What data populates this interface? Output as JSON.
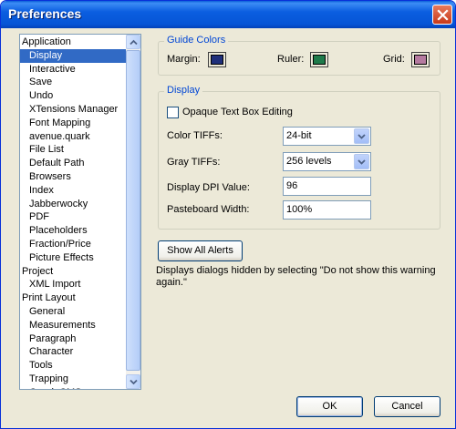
{
  "window": {
    "title": "Preferences"
  },
  "categories": [
    {
      "label": "Application",
      "level": 0
    },
    {
      "label": "Display",
      "level": 1,
      "selected": true
    },
    {
      "label": "Interactive",
      "level": 1
    },
    {
      "label": "Save",
      "level": 1
    },
    {
      "label": "Undo",
      "level": 1
    },
    {
      "label": "XTensions Manager",
      "level": 1
    },
    {
      "label": "Font Mapping",
      "level": 1
    },
    {
      "label": "avenue.quark",
      "level": 1
    },
    {
      "label": "File List",
      "level": 1
    },
    {
      "label": "Default Path",
      "level": 1
    },
    {
      "label": "Browsers",
      "level": 1
    },
    {
      "label": "Index",
      "level": 1
    },
    {
      "label": "Jabberwocky",
      "level": 1
    },
    {
      "label": "PDF",
      "level": 1
    },
    {
      "label": "Placeholders",
      "level": 1
    },
    {
      "label": "Fraction/Price",
      "level": 1
    },
    {
      "label": "Picture Effects",
      "level": 1
    },
    {
      "label": "Project",
      "level": 0
    },
    {
      "label": "XML Import",
      "level": 1
    },
    {
      "label": "Print Layout",
      "level": 0
    },
    {
      "label": "General",
      "level": 1
    },
    {
      "label": "Measurements",
      "level": 1
    },
    {
      "label": "Paragraph",
      "level": 1
    },
    {
      "label": "Character",
      "level": 1
    },
    {
      "label": "Tools",
      "level": 1
    },
    {
      "label": "Trapping",
      "level": 1
    },
    {
      "label": "Quark CMS",
      "level": 1
    }
  ],
  "guide_colors": {
    "title": "Guide Colors",
    "margin_label": "Margin:",
    "ruler_label": "Ruler:",
    "grid_label": "Grid:",
    "margin_color": "#1f2f7a",
    "ruler_color": "#1e7a4a",
    "grid_color": "#b57aa0"
  },
  "display": {
    "title": "Display",
    "opaque_label": "Opaque Text Box Editing",
    "opaque_checked": false,
    "color_tiffs_label": "Color TIFFs:",
    "color_tiffs_value": "24-bit",
    "gray_tiffs_label": "Gray TIFFs:",
    "gray_tiffs_value": "256 levels",
    "dpi_label": "Display DPI Value:",
    "dpi_value": "96",
    "pasteboard_label": "Pasteboard Width:",
    "pasteboard_value": "100%"
  },
  "alerts": {
    "button_label": "Show All Alerts",
    "description": "Displays dialogs hidden by selecting \"Do not show this warning again.\""
  },
  "footer": {
    "ok_label": "OK",
    "cancel_label": "Cancel"
  }
}
